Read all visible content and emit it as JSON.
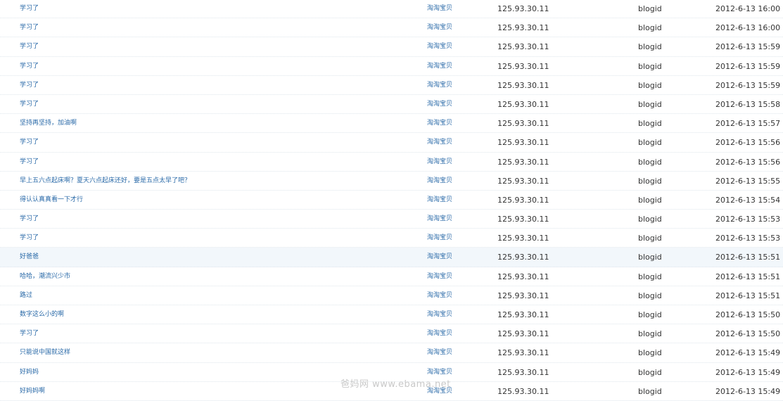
{
  "rows": [
    {
      "content": "学习了",
      "user": "淘淘宝贝",
      "ip": "125.93.30.11",
      "type": "blogid",
      "time": "2012-6-13 16:00"
    },
    {
      "content": "学习了",
      "user": "淘淘宝贝",
      "ip": "125.93.30.11",
      "type": "blogid",
      "time": "2012-6-13 16:00"
    },
    {
      "content": "学习了",
      "user": "淘淘宝贝",
      "ip": "125.93.30.11",
      "type": "blogid",
      "time": "2012-6-13 15:59"
    },
    {
      "content": "学习了",
      "user": "淘淘宝贝",
      "ip": "125.93.30.11",
      "type": "blogid",
      "time": "2012-6-13 15:59"
    },
    {
      "content": "学习了",
      "user": "淘淘宝贝",
      "ip": "125.93.30.11",
      "type": "blogid",
      "time": "2012-6-13 15:59"
    },
    {
      "content": "学习了",
      "user": "淘淘宝贝",
      "ip": "125.93.30.11",
      "type": "blogid",
      "time": "2012-6-13 15:58"
    },
    {
      "content": "坚持再坚持，加油啊",
      "user": "淘淘宝贝",
      "ip": "125.93.30.11",
      "type": "blogid",
      "time": "2012-6-13 15:57"
    },
    {
      "content": "学习了",
      "user": "淘淘宝贝",
      "ip": "125.93.30.11",
      "type": "blogid",
      "time": "2012-6-13 15:56"
    },
    {
      "content": "学习了",
      "user": "淘淘宝贝",
      "ip": "125.93.30.11",
      "type": "blogid",
      "time": "2012-6-13 15:56"
    },
    {
      "content": "早上五六点起床啊？夏天六点起床还好，要是五点太早了吧？",
      "user": "淘淘宝贝",
      "ip": "125.93.30.11",
      "type": "blogid",
      "time": "2012-6-13 15:55"
    },
    {
      "content": "得认认真真看一下才行",
      "user": "淘淘宝贝",
      "ip": "125.93.30.11",
      "type": "blogid",
      "time": "2012-6-13 15:54"
    },
    {
      "content": "学习了",
      "user": "淘淘宝贝",
      "ip": "125.93.30.11",
      "type": "blogid",
      "time": "2012-6-13 15:53"
    },
    {
      "content": "学习了",
      "user": "淘淘宝贝",
      "ip": "125.93.30.11",
      "type": "blogid",
      "time": "2012-6-13 15:53"
    },
    {
      "content": "好爸爸",
      "user": "淘淘宝贝",
      "ip": "125.93.30.11",
      "type": "blogid",
      "time": "2012-6-13 15:51",
      "highlighted": true
    },
    {
      "content": "哈哈，潮流兴少市",
      "user": "淘淘宝贝",
      "ip": "125.93.30.11",
      "type": "blogid",
      "time": "2012-6-13 15:51"
    },
    {
      "content": "路过",
      "user": "淘淘宝贝",
      "ip": "125.93.30.11",
      "type": "blogid",
      "time": "2012-6-13 15:51"
    },
    {
      "content": "数字这么小的啊",
      "user": "淘淘宝贝",
      "ip": "125.93.30.11",
      "type": "blogid",
      "time": "2012-6-13 15:50"
    },
    {
      "content": "学习了",
      "user": "淘淘宝贝",
      "ip": "125.93.30.11",
      "type": "blogid",
      "time": "2012-6-13 15:50"
    },
    {
      "content": "只能说中国就这样",
      "user": "淘淘宝贝",
      "ip": "125.93.30.11",
      "type": "blogid",
      "time": "2012-6-13 15:49"
    },
    {
      "content": "好妈妈",
      "user": "淘淘宝贝",
      "ip": "125.93.30.11",
      "type": "blogid",
      "time": "2012-6-13 15:49"
    },
    {
      "content": "好妈妈啊",
      "user": "淘淘宝贝",
      "ip": "125.93.30.11",
      "type": "blogid",
      "time": "2012-6-13 15:49"
    }
  ],
  "watermark": "爸妈网 www.ebama.net"
}
